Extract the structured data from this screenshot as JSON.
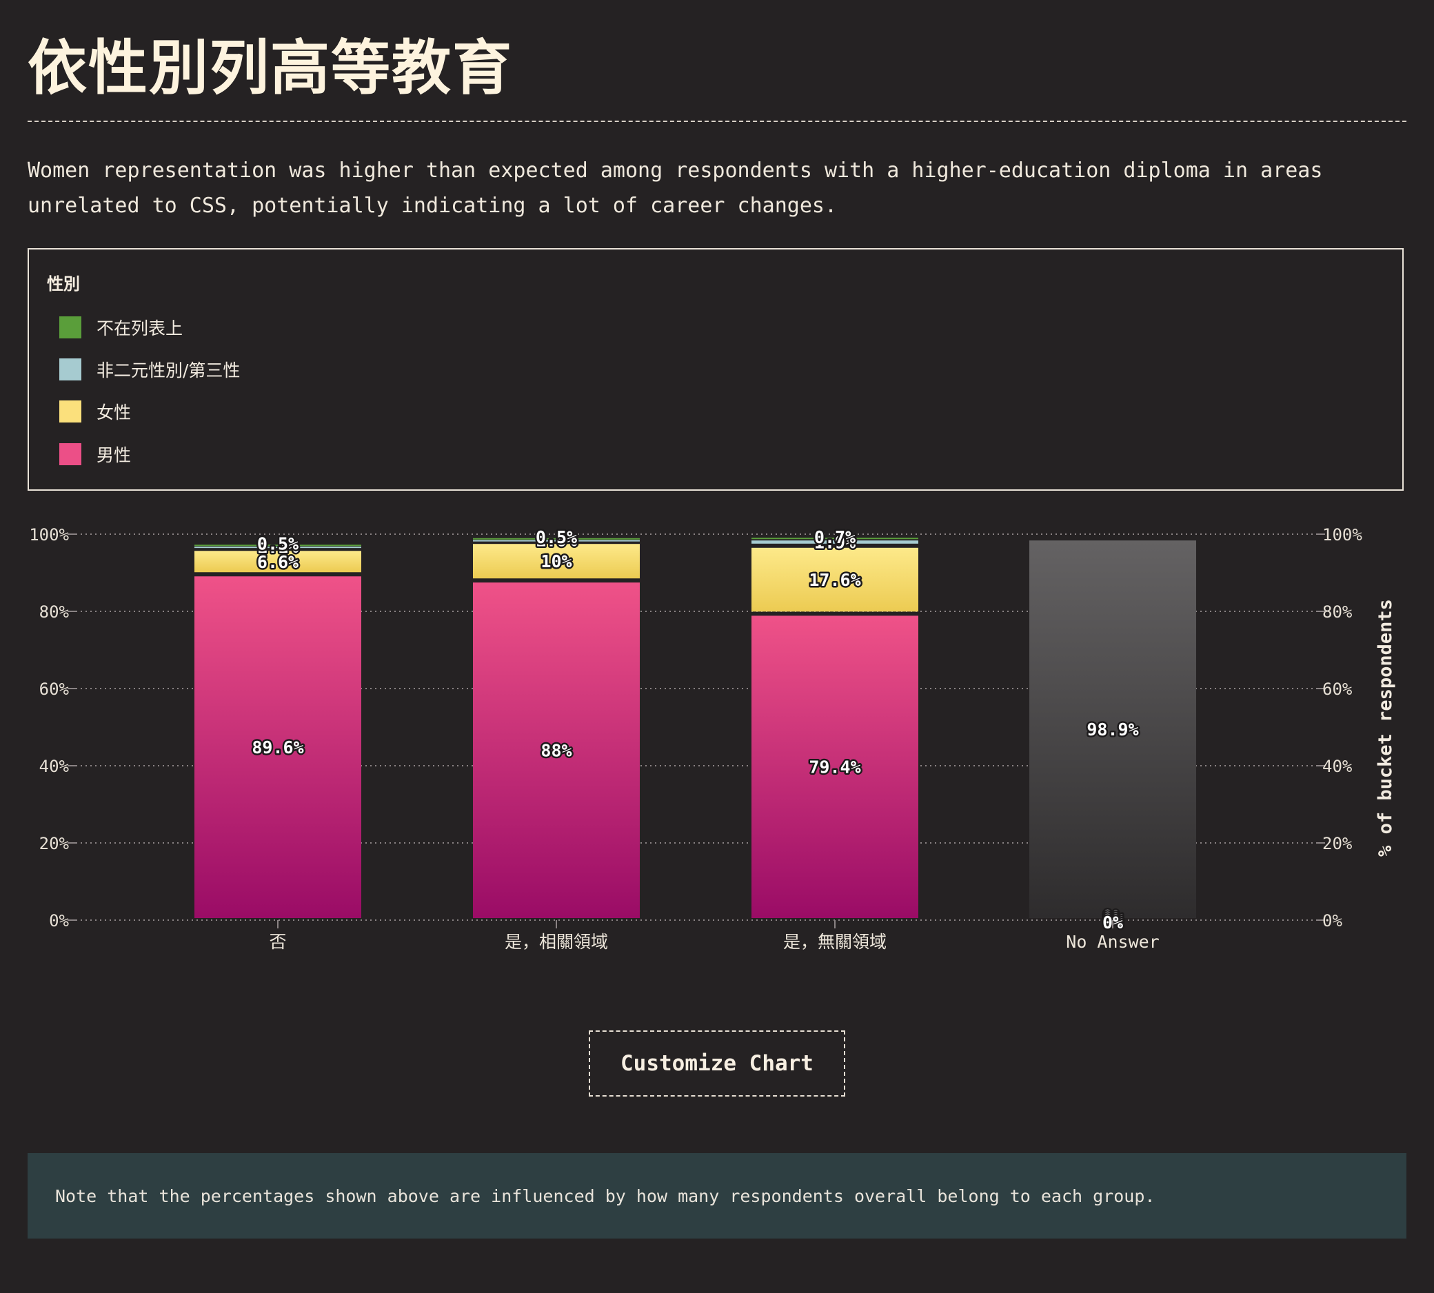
{
  "page": {
    "title": "依性別列高等教育",
    "description": "Women representation was higher than expected among respondents with a higher-education diploma in areas unrelated to CSS, potentially indicating a lot of career changes.",
    "customize_label": "Customize Chart",
    "note": "Note that the percentages shown above are influenced by how many respondents overall belong to each group."
  },
  "legend": {
    "title": "性別",
    "items": [
      {
        "label": "不在列表上",
        "color": "#5a9e3a"
      },
      {
        "label": "非二元性別/第三性",
        "color": "#a6cbd0"
      },
      {
        "label": "女性",
        "color": "#fbe07c"
      },
      {
        "label": "男性",
        "color": "#ec4f87"
      }
    ]
  },
  "colors": {
    "background": "#252223",
    "male_top": "#ef5288",
    "male_bottom": "#9a0c66",
    "female_top": "#fde98a",
    "female_bottom": "#eccb52",
    "nonbinary": "#a6cbd0",
    "not_listed": "#5a9e3a",
    "no_answer_top": "#646263",
    "no_answer_bottom": "#2e2c2d"
  },
  "chart_data": {
    "type": "bar",
    "stacked": true,
    "categories": [
      "否",
      "是，相關領域",
      "是，無關領域",
      "No Answer"
    ],
    "series": [
      {
        "name": "男性",
        "values": [
          89.6,
          88,
          79.4,
          0
        ],
        "labels": [
          "89.6%",
          "88%",
          "79.4%",
          "0%"
        ]
      },
      {
        "name": "女性",
        "values": [
          6.6,
          10,
          17.6,
          0
        ],
        "labels": [
          "6.6%",
          "10%",
          "17.6%",
          "0%"
        ]
      },
      {
        "name": "非二元性別/第三性",
        "values": [
          1.1,
          1.0,
          1.9,
          0
        ],
        "labels": [
          "1.1%",
          "1.0%",
          "1.9%",
          "0%"
        ]
      },
      {
        "name": "不在列表上",
        "values": [
          0.5,
          0.5,
          0.7,
          0
        ],
        "labels": [
          "0.5%",
          "0.5%",
          "0.7%",
          "0%"
        ]
      },
      {
        "name": "No Answer",
        "values": [
          0,
          0,
          0,
          98.9
        ],
        "labels": [
          "",
          "",
          "",
          "98.9%"
        ]
      }
    ],
    "y_ticks": [
      "0%",
      "20%",
      "40%",
      "60%",
      "80%",
      "100%"
    ],
    "ylim": [
      0,
      100
    ],
    "ylabel_right": "% of bucket respondents",
    "grid": true
  }
}
